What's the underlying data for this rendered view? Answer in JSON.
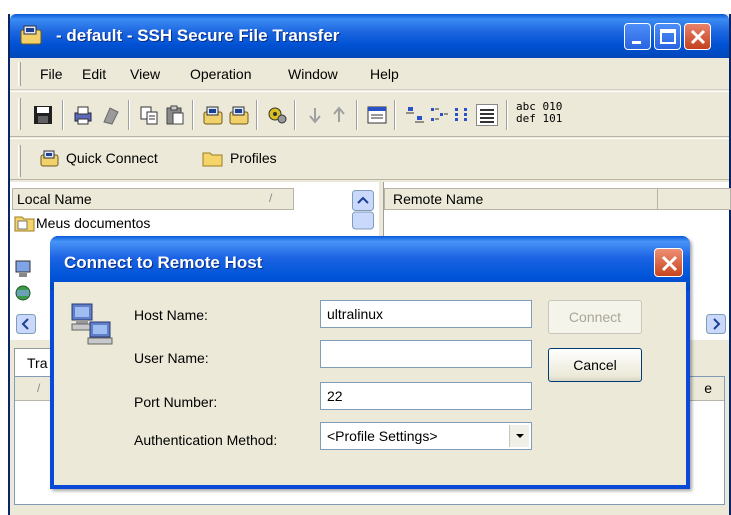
{
  "window": {
    "title": " - default - SSH Secure File Transfer"
  },
  "menu": [
    {
      "label": "File"
    },
    {
      "label": "Edit"
    },
    {
      "label": "View"
    },
    {
      "label": "Operation"
    },
    {
      "label": "Window"
    },
    {
      "label": "Help"
    }
  ],
  "toolbar": {
    "abc_line1": "abc 010",
    "abc_line2": "def 101",
    "quick_connect": "Quick Connect",
    "profiles": "Profiles"
  },
  "local_pane": {
    "header": "Local Name",
    "sort_indicator": "/",
    "items": [
      {
        "label": "Meus documentos"
      }
    ]
  },
  "remote_pane": {
    "header": "Remote Name"
  },
  "transfer": {
    "tab_label": "Tra",
    "sort_indicator": "/",
    "col_stub": "e"
  },
  "dialog": {
    "title": "Connect to Remote Host",
    "host_label": "Host Name:",
    "host_value": "ultralinux",
    "user_label": "User Name:",
    "user_value": "",
    "port_label": "Port Number:",
    "port_value": "22",
    "auth_label": "Authentication Method:",
    "auth_value": "<Profile Settings>",
    "connect_label": "Connect",
    "cancel_label": "Cancel"
  },
  "colors": {
    "titlebar": "#0054d8",
    "dialog_frame": "#0a48d8",
    "face": "#ece9d8",
    "close_button": "#c9441f"
  }
}
